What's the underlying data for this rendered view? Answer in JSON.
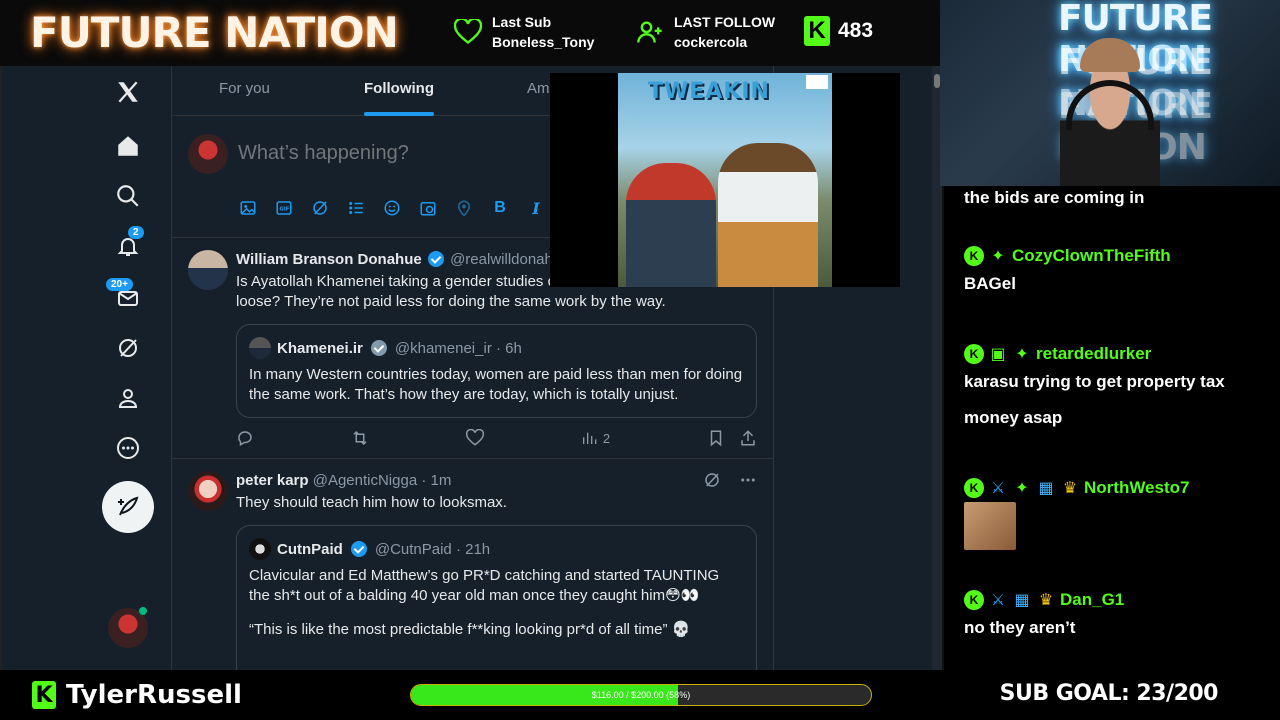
{
  "stream": {
    "logo_text": "FUTURE NATION",
    "last_sub": {
      "label": "Last Sub",
      "name": "Boneless_Tony"
    },
    "last_follow": {
      "label": "LAST FOLLOW",
      "name": "cockercola"
    },
    "viewer_count": "483",
    "kick_badge": "K",
    "channel_name": "TylerRussell",
    "goal_bar_text": "$116.00 / $200.00 (58%)",
    "goal_fraction": 0.58,
    "sub_goal": "SUB GOAL: 23/200",
    "accent_color": "#53fc18"
  },
  "nav": {
    "notifications_badge": "2",
    "messages_badge": "20+"
  },
  "feed": {
    "tabs": [
      {
        "label": "For you"
      },
      {
        "label": "Following"
      },
      {
        "label": "Am"
      }
    ],
    "composer_placeholder": "What’s happening?",
    "tweets": [
      {
        "name": "William Branson Donahue",
        "handle": "@realwilldonah",
        "text": "Is Ayatollah Khamenei taking a gender studies course or are his marbles loose? They’re not paid less for doing the same work by the way.",
        "quote": {
          "name": "Khamenei.ir",
          "handle": "@khamenei_ir · 6h",
          "text": "In many Western countries today, women are paid less than men for doing the same work. That’s how they are today, which is totally unjust."
        },
        "views": "2"
      },
      {
        "name": "peter karp",
        "handle": "@AgenticNigga · 1m",
        "text": "They should teach him how to looksmax.",
        "quote": {
          "name": "CutnPaid",
          "handle": "@CutnPaid · 21h",
          "text": "Clavicular and Ed Matthew’s go PR*D catching and started TAUNTING the sh*t out of a balding 40 year old man once they caught him😳👀",
          "text2": "“This is like the most predictable f**king looking pr*d of all time” 💀"
        }
      }
    ]
  },
  "album": {
    "title": "TWEAKIN"
  },
  "chat": {
    "messages": [
      {
        "user": "",
        "text": "the bids are coming in"
      },
      {
        "user": "CozyClownTheFifth",
        "text": "BAGel",
        "color": "#53fc18"
      },
      {
        "user": "retardedlurker",
        "text": "karasu trying to get property tax money asap",
        "color": "#53fc18"
      },
      {
        "user": "NorthWesto7",
        "text": "",
        "color": "#53fc18"
      },
      {
        "user": "Dan_G1",
        "text": "no they aren’t",
        "color": "#53fc18"
      }
    ]
  }
}
